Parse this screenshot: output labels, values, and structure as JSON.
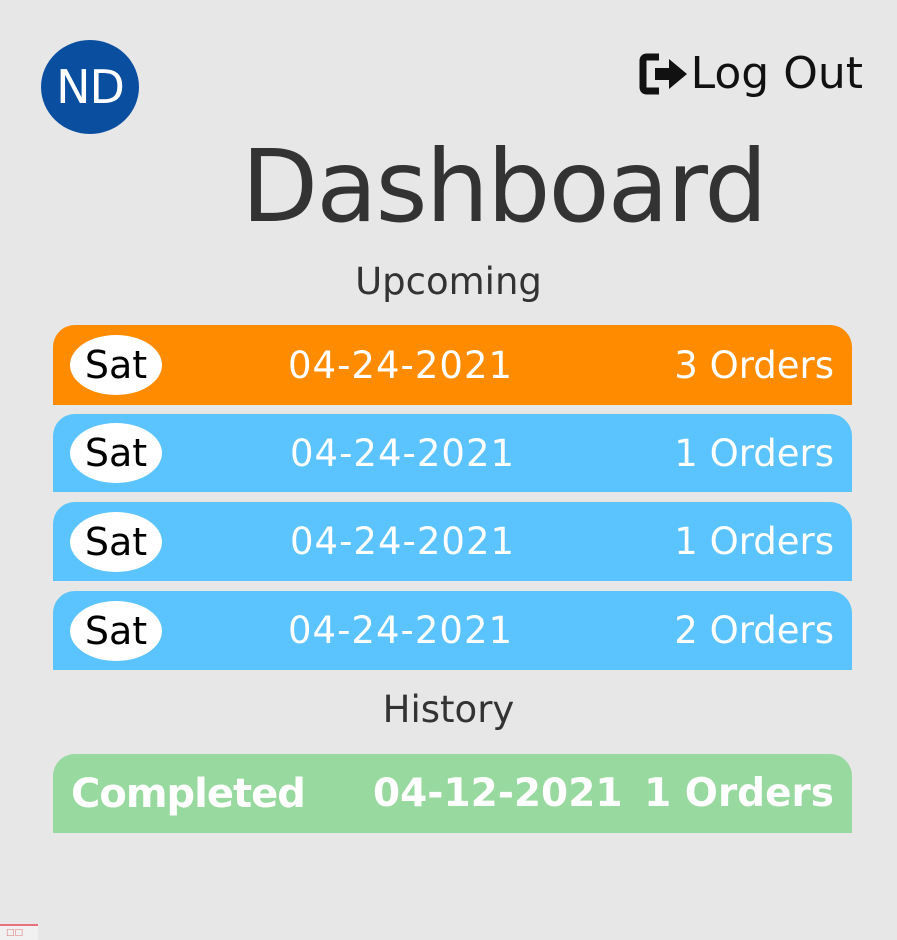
{
  "user": {
    "initials": "ND"
  },
  "header": {
    "logout_label": "Log Out"
  },
  "page": {
    "title": "Dashboard"
  },
  "upcoming": {
    "label": "Upcoming",
    "items": [
      {
        "day": "Sat",
        "date": "04-24-2021",
        "orders": "3 Orders",
        "color": "#ff8c00"
      },
      {
        "day": "Sat",
        "date": "04-24-2021",
        "orders": "1 Orders",
        "color": "#5bc3fd"
      },
      {
        "day": "Sat",
        "date": "04-24-2021",
        "orders": "1 Orders",
        "color": "#5bc3fd"
      },
      {
        "day": "Sat",
        "date": "04-24-2021",
        "orders": "2 Orders",
        "color": "#5bc3fd"
      }
    ]
  },
  "history": {
    "label": "History",
    "items": [
      {
        "status": "Completed",
        "date": "04-12-2021",
        "orders": "1 Orders",
        "color": "#97d99e"
      }
    ]
  },
  "icons": {
    "logout": "sign-out-icon",
    "corner": "broken-image-icon"
  }
}
